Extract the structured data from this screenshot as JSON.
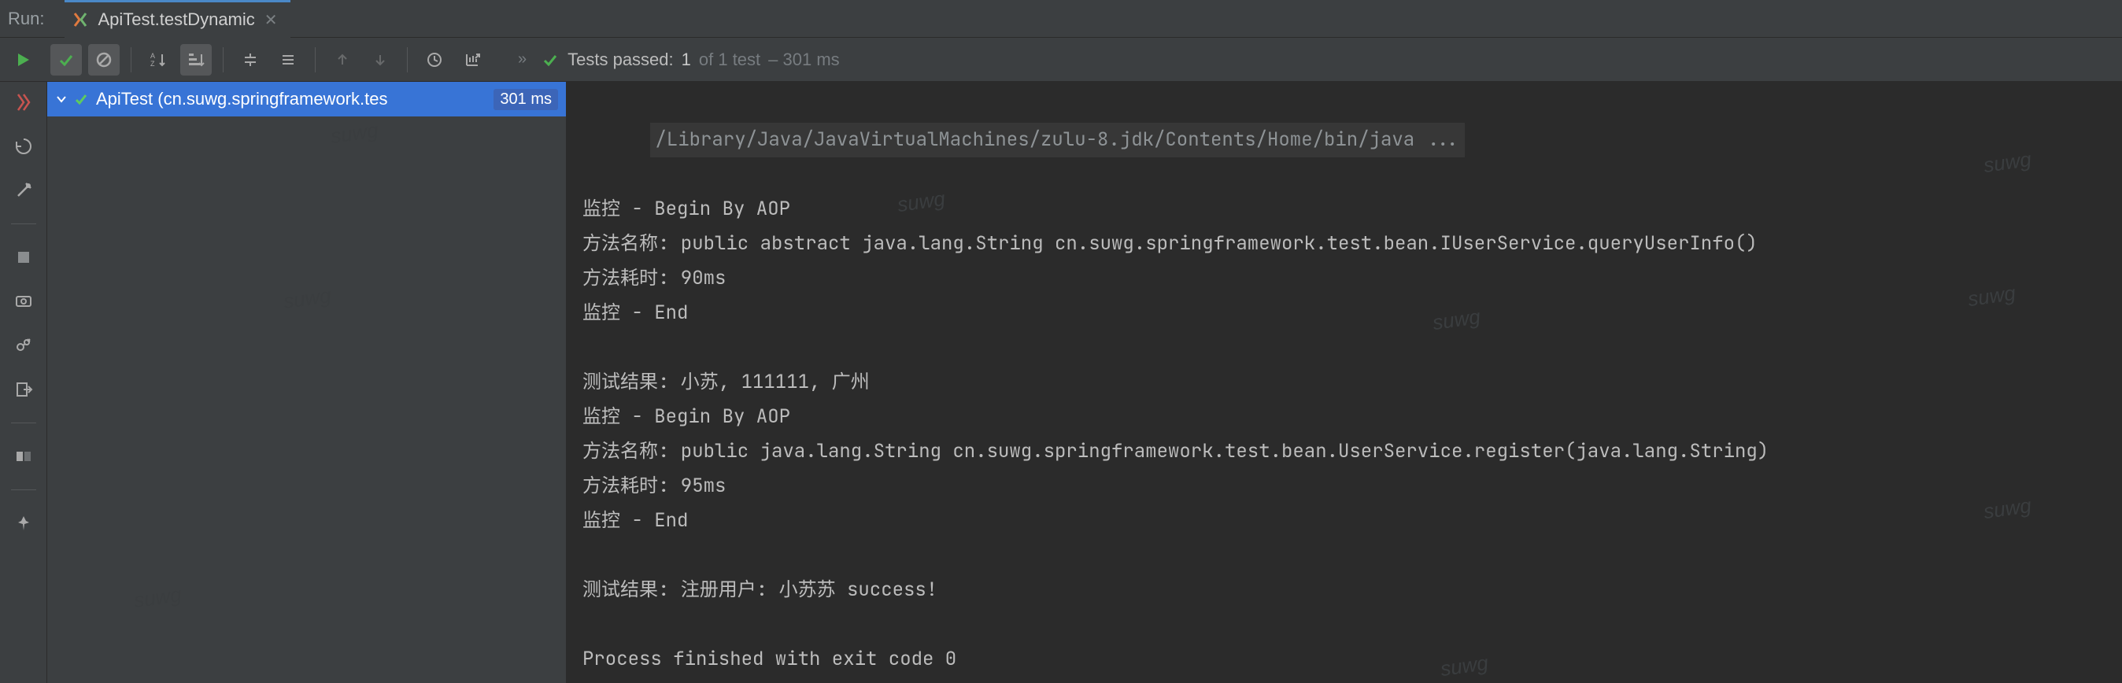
{
  "header": {
    "run_label": "Run:",
    "tab_title": "ApiTest.testDynamic"
  },
  "toolbar": {
    "status_prefix": "Tests passed:",
    "status_count": "1",
    "status_of": "of 1 test",
    "status_time": "– 301 ms"
  },
  "tree": {
    "row_name": "ApiTest (cn.suwg.springframework.tes",
    "row_time": "301 ms"
  },
  "console": {
    "cmd": "/Library/Java/JavaVirtualMachines/zulu-8.jdk/Contents/Home/bin/java ...",
    "lines": [
      "监控 - Begin By AOP",
      "方法名称: public abstract java.lang.String cn.suwg.springframework.test.bean.IUserService.queryUserInfo()",
      "方法耗时: 90ms",
      "监控 - End",
      "",
      "测试结果: 小苏, 111111, 广州",
      "监控 - Begin By AOP",
      "方法名称: public java.lang.String cn.suwg.springframework.test.bean.UserService.register(java.lang.String)",
      "方法耗时: 95ms",
      "监控 - End",
      "",
      "测试结果: 注册用户: 小苏苏 success!",
      "",
      "Process finished with exit code 0"
    ]
  },
  "watermark": "suwg"
}
